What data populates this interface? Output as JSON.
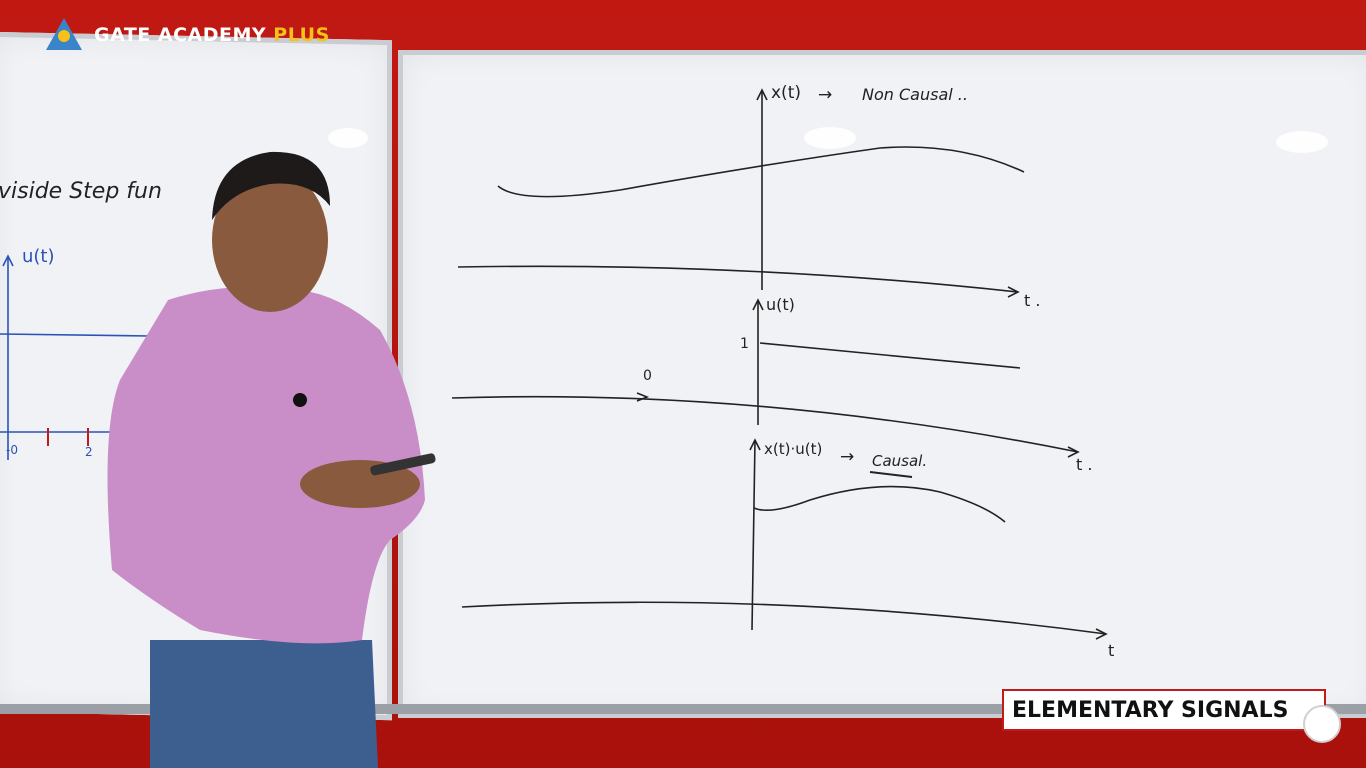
{
  "branding": {
    "name": "GATE ACADEMY",
    "suffix": "PLUS",
    "colors": {
      "wall": "#b5140f",
      "plus": "#f6c21a",
      "caption_border": "#c21a1a"
    }
  },
  "caption": {
    "title": "ELEMENTARY SIGNALS"
  },
  "whiteboard_right": {
    "plot1": {
      "y_label": "x(t)",
      "arrow": "→",
      "note": "Non Causal ..",
      "t_label": "t ."
    },
    "plot2": {
      "y_label": "u(t)",
      "level": "1",
      "origin": "0",
      "t_label": "t ."
    },
    "plot3": {
      "y_label": "x(t)·u(t)",
      "arrow": "→",
      "note": "Causal.",
      "t_label": "t"
    }
  },
  "whiteboard_left": {
    "heading": "viside Step fun",
    "y_label": "u(t)",
    "ticks": [
      "-0",
      "2"
    ]
  }
}
